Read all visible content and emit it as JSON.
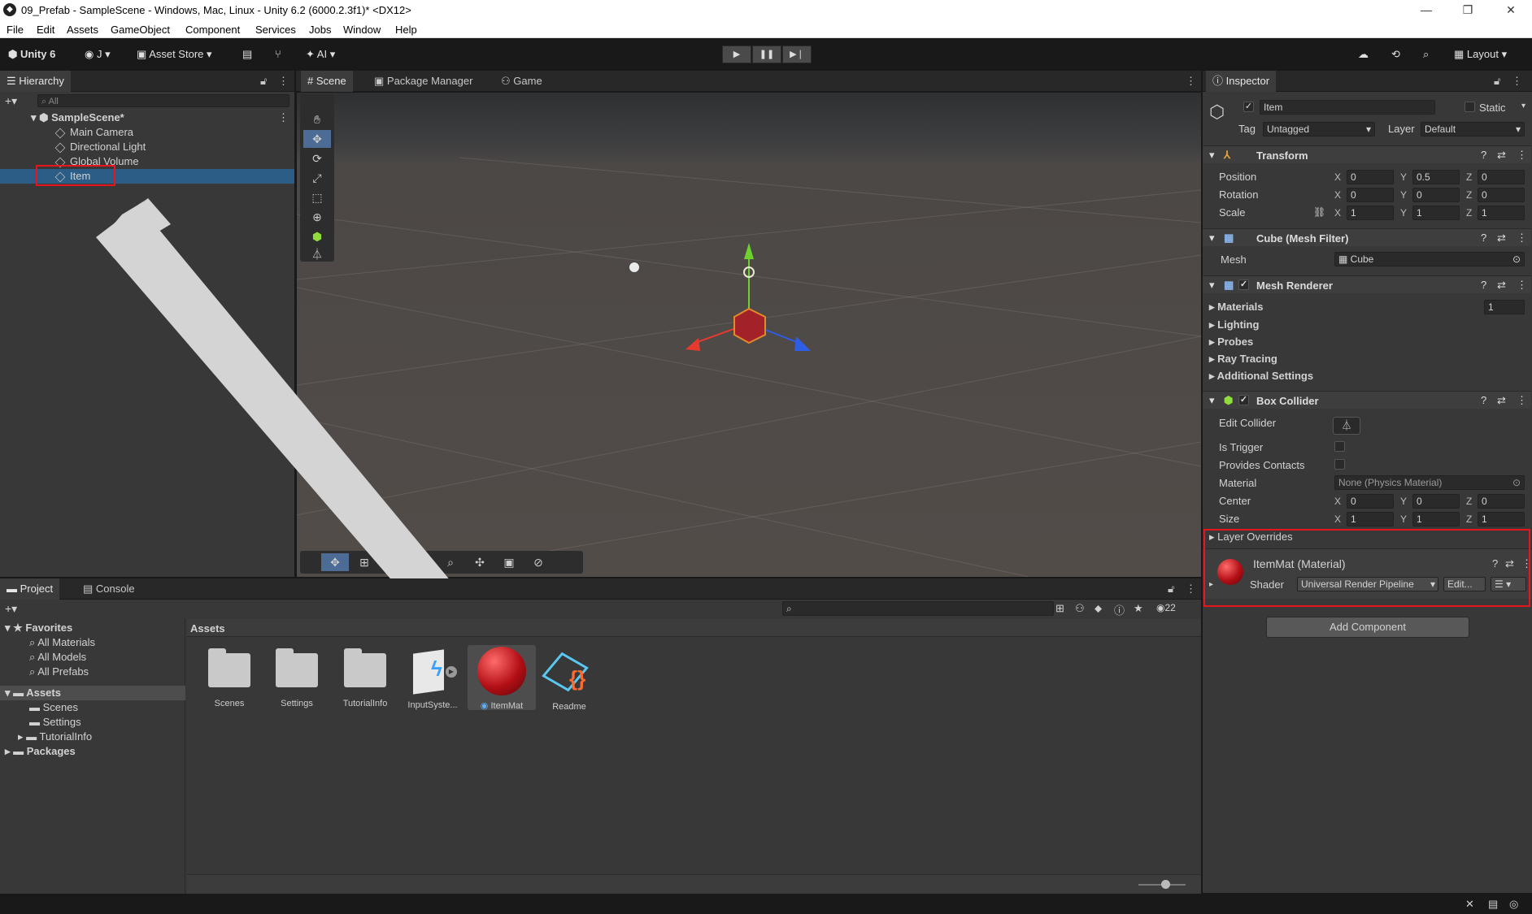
{
  "window": {
    "title": "09_Prefab - SampleScene - Windows, Mac, Linux - Unity 6.2 (6000.2.3f1)* <DX12>"
  },
  "menu": [
    "File",
    "Edit",
    "Assets",
    "GameObject",
    "Component",
    "Services",
    "Jobs",
    "Window",
    "Help"
  ],
  "toolbar": {
    "unity_label": "Unity 6",
    "account": "J",
    "asset_store": "Asset Store",
    "ai": "AI",
    "layout": "Layout"
  },
  "hierarchy": {
    "tab": "Hierarchy",
    "search_placeholder": "All",
    "scene": "SampleScene*",
    "items": [
      "Main Camera",
      "Directional Light",
      "Global Volume",
      "Item"
    ]
  },
  "center_tabs": [
    "Scene",
    "Package Manager",
    "Game"
  ],
  "inspector": {
    "tab": "Inspector",
    "object_name": "Item",
    "static_label": "Static",
    "tag_label": "Tag",
    "tag_value": "Untagged",
    "layer_label": "Layer",
    "layer_value": "Default",
    "transform": {
      "title": "Transform",
      "position": {
        "label": "Position",
        "x": "0",
        "y": "0.5",
        "z": "0"
      },
      "rotation": {
        "label": "Rotation",
        "x": "0",
        "y": "0",
        "z": "0"
      },
      "scale": {
        "label": "Scale",
        "x": "1",
        "y": "1",
        "z": "1"
      }
    },
    "mesh_filter": {
      "title": "Cube (Mesh Filter)",
      "mesh_label": "Mesh",
      "mesh_value": "Cube"
    },
    "mesh_renderer": {
      "title": "Mesh Renderer",
      "materials": "Materials",
      "materials_count": "1",
      "lighting": "Lighting",
      "probes": "Probes",
      "ray_tracing": "Ray Tracing",
      "additional": "Additional Settings"
    },
    "box_collider": {
      "title": "Box Collider",
      "edit_collider": "Edit Collider",
      "is_trigger": "Is Trigger",
      "provides_contacts": "Provides Contacts",
      "material_label": "Material",
      "material_value": "None (Physics Material)",
      "center": {
        "label": "Center",
        "x": "0",
        "y": "0",
        "z": "0"
      },
      "size": {
        "label": "Size",
        "x": "1",
        "y": "1",
        "z": "1"
      },
      "layer_overrides": "Layer Overrides"
    },
    "material": {
      "title": "ItemMat (Material)",
      "shader_label": "Shader",
      "shader_value": "Universal Render Pipeline",
      "edit": "Edit..."
    },
    "add_component": "Add Component"
  },
  "project": {
    "tabs": [
      "Project",
      "Console"
    ],
    "favorites": "Favorites",
    "fav_items": [
      "All Materials",
      "All Models",
      "All Prefabs"
    ],
    "assets_root": "Assets",
    "asset_folders": [
      "Scenes",
      "Settings",
      "TutorialInfo"
    ],
    "packages": "Packages",
    "breadcrumb": "Assets",
    "hidden_count": "22",
    "grid": [
      "Scenes",
      "Settings",
      "TutorialInfo",
      "InputSyste...",
      "ItemMat",
      "Readme"
    ]
  },
  "colors": {
    "highlight": "#e8141e",
    "selection": "#2c5d87",
    "accent_x": "#e63a2e",
    "accent_y": "#6fd12e",
    "accent_z": "#2e5ee6"
  }
}
